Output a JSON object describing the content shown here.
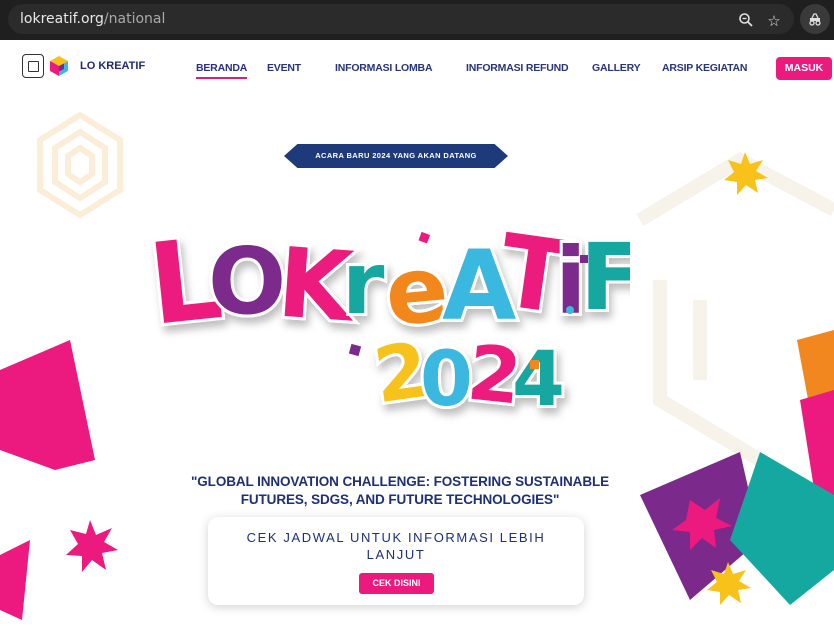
{
  "browser": {
    "url_domain": "lokreatif.org",
    "url_path": "/national",
    "icons": [
      "zoom-icon",
      "star-icon",
      "extension-icon"
    ]
  },
  "nav": {
    "brand": "LO KREATIF",
    "items": [
      {
        "label": "BERANDA",
        "active": true
      },
      {
        "label": "EVENT"
      },
      {
        "label": "INFORMASI LOMBA"
      },
      {
        "label": "INFORMASI REFUND"
      },
      {
        "label": "GALLERY"
      },
      {
        "label": "ARSIP KEGIATAN"
      }
    ],
    "login_label": "MASUK"
  },
  "hero": {
    "ribbon": "ACARA BARU 2024 YANG AKAN DATANG",
    "logo_line1": "LOKREATIF",
    "logo_line2": "2024",
    "tagline": "\"GLOBAL INNOVATION CHALLENGE: FOSTERING SUSTAINABLE FUTURES, SDGS, AND FUTURE TECHNOLOGIES\"",
    "card_text": "CEK JADWAL UNTUK INFORMASI LEBIH LANJUT",
    "cta_label": "CEK DISINI"
  },
  "colors": {
    "pink": "#ec1a7e",
    "navy": "#1e2f7a",
    "teal": "#14a8a0",
    "purple": "#7b2a8c",
    "yellow": "#f8c21b",
    "orange": "#f2871f",
    "cyan": "#3ab8e0"
  }
}
